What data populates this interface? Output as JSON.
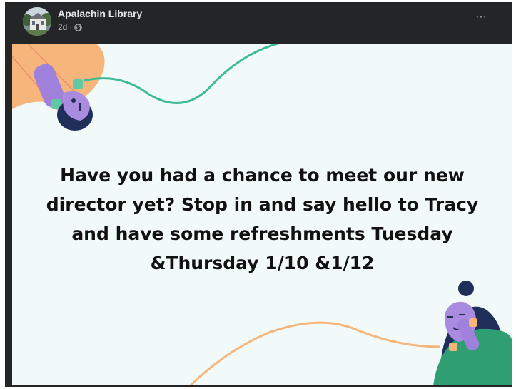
{
  "post": {
    "page_name": "Apalachin Library",
    "timestamp": "2d",
    "separator": "·",
    "audience_icon": "globe-icon",
    "menu_icon": "more-options-icon",
    "menu_label": "···"
  },
  "image": {
    "message_lines": [
      "Have you had a chance to meet our new",
      "director yet? Stop in and say hello to Tracy",
      "and have some refreshments Tuesday",
      "&Thursday 1/10 &1/12"
    ],
    "colors": {
      "background": "#f1faf8",
      "orange": "#f6b67b",
      "teal": "#3dbb96",
      "purple": "#a98be0",
      "green": "#2f9e73",
      "navy": "#1f2f5a"
    }
  }
}
